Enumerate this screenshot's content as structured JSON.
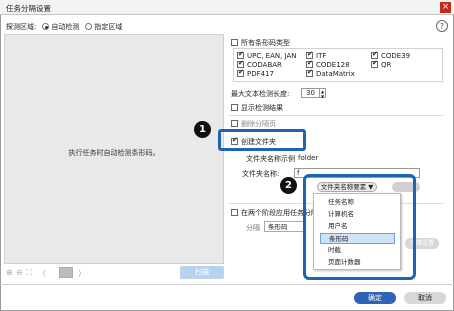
{
  "window": {
    "title": "任务分隔设置",
    "close": "×"
  },
  "scan_area": {
    "label": "探测区域:",
    "options": [
      "自动检测",
      "指定区域"
    ],
    "selected": "自动检测"
  },
  "preview": {
    "message": "执行任务时自动检测条形码。",
    "scan_button": "扫描"
  },
  "barcode_types": {
    "all_label": "所有条形码类型",
    "items": [
      "UPC, EAN, JAN",
      "ITF",
      "CODE39",
      "CODABAR",
      "CODE128",
      "QR",
      "PDF417",
      "DataMatrix"
    ]
  },
  "max_length": {
    "label": "最大文本检测长度:",
    "value": "30"
  },
  "show_result": {
    "label": "显示检测结果"
  },
  "delete_label": "删除分隔页",
  "create_folder": {
    "label": "创建文件夹",
    "checked": true
  },
  "folder_name_example": {
    "label": "文件夹名称示例",
    "value": "folder"
  },
  "folder_name": {
    "label": "文件夹名称:",
    "value": "f"
  },
  "folder_name_elements": {
    "button": "文件夹名称要素 ▼",
    "options": [
      "任务名称",
      "计算机名",
      "用户名",
      "条形码",
      "时截",
      "页面计数器"
    ],
    "highlighted": "条形码"
  },
  "two_stage": {
    "label": "在两个阶段应用任务分隔"
  },
  "separator": {
    "label": "分隔",
    "value": "条形码",
    "right_button": "分隔设置"
  },
  "callouts": [
    "1",
    "2"
  ],
  "footer": {
    "ok": "确定",
    "cancel": "取消"
  },
  "colors": {
    "accent": "#2d64b8",
    "callout": "#1f63b4"
  }
}
